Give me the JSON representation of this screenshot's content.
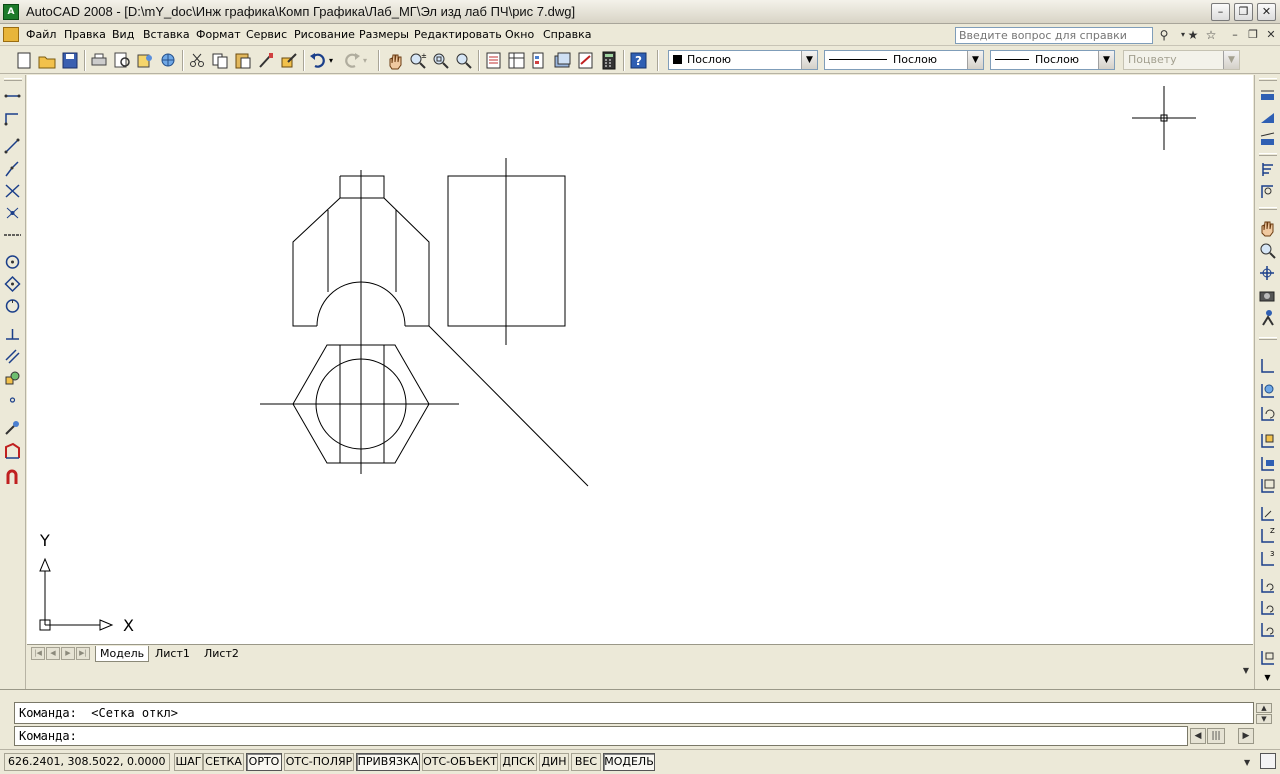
{
  "window": {
    "title": "AutoCAD 2008 - [D:\\mY_doc\\Инж графика\\Комп Графика\\Лаб_МГ\\Эл изд лаб ПЧ\\рис 7.dwg]",
    "app_icon_text": "A"
  },
  "menu": {
    "items": [
      "Файл",
      "Правка",
      "Вид",
      "Вставка",
      "Формат",
      "Сервис",
      "Рисование",
      "Размеры",
      "Редактировать",
      "Окно",
      "Справка"
    ],
    "help_placeholder": "Введите вопрос для справки"
  },
  "toolbar": {
    "color_combo": "Послою",
    "linetype_combo": "Послою",
    "lineweight_combo": "Послою",
    "plotstyle_combo": "Поцвету"
  },
  "canvas": {
    "ucs_x_label": "X",
    "ucs_y_label": "Y"
  },
  "tabs": {
    "items": [
      "Модель",
      "Лист1",
      "Лист2"
    ],
    "active": "Модель"
  },
  "command": {
    "history": "Команда:  <Сетка откл>",
    "prompt": "Команда:"
  },
  "status": {
    "coordinates": "626.2401,  308.5022, 0.0000",
    "toggles": [
      {
        "label": "ШАГ",
        "on": false
      },
      {
        "label": "СЕТКА",
        "on": false
      },
      {
        "label": "ОРТО",
        "on": true
      },
      {
        "label": "ОТС-ПОЛЯР",
        "on": false
      },
      {
        "label": "ПРИВЯЗКА",
        "on": true
      },
      {
        "label": "ОТС-ОБЪЕКТ",
        "on": false
      },
      {
        "label": "ДПСК",
        "on": false
      },
      {
        "label": "ДИН",
        "on": false
      },
      {
        "label": "ВЕС",
        "on": false
      },
      {
        "label": "МОДЕЛЬ",
        "on": true
      }
    ]
  },
  "colors": {
    "canvas_bg": "#ffffff",
    "chrome_bg": "#ece9d8",
    "line_color": "#000000"
  }
}
